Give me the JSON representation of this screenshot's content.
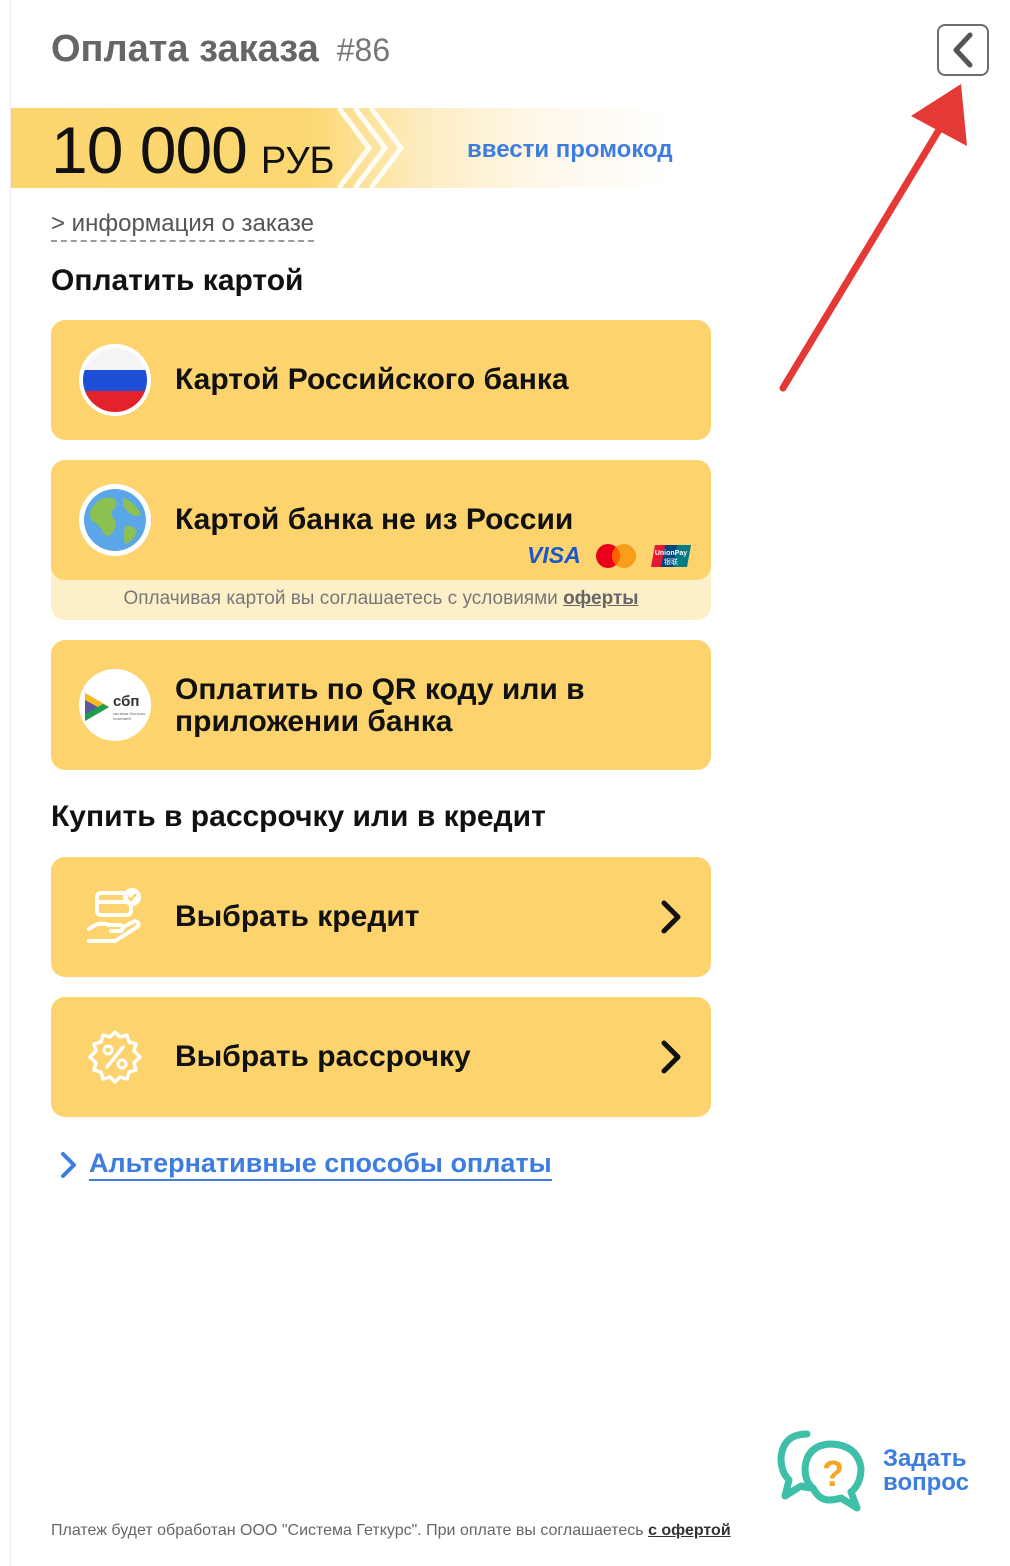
{
  "header": {
    "title": "Оплата заказа",
    "order_number": "#86"
  },
  "amount": {
    "value": "10 000",
    "currency": "РУБ",
    "promo_link": "ввести промокод"
  },
  "order_info_link": "> информация о заказе",
  "card_section": {
    "heading": "Оплатить картой",
    "russian_card": {
      "label": "Картой Российского банка"
    },
    "foreign_card": {
      "label": "Картой банка не из России",
      "brands": [
        "VISA",
        "mastercard",
        "UnionPay"
      ],
      "offer_text": "Оплачивая картой вы соглашаетесь с условиями",
      "offer_link": "оферты"
    },
    "sbp": {
      "label_line1": "Оплатить по QR коду или в",
      "label_line2": "приложении банка",
      "logo_text": "сбп",
      "logo_subtext": "система быстрых платежей"
    }
  },
  "credit_section": {
    "heading": "Купить в рассрочку или в кредит",
    "credit": {
      "label": "Выбрать кредит"
    },
    "installment": {
      "label": "Выбрать рассрочку"
    }
  },
  "alt_link": "Альтернативные способы оплаты",
  "ask_question": {
    "line1": "Задать",
    "line2": "вопрос"
  },
  "footer": {
    "text": "Платеж будет обработан ООО \"Система Геткурс\". При оплате вы соглашаетесь",
    "link": "с офертой"
  },
  "colors": {
    "accent_yellow": "#fdd36e",
    "link_blue": "#3d7de0",
    "annotation_red": "#e53935",
    "chat_teal": "#3dbfa8"
  }
}
